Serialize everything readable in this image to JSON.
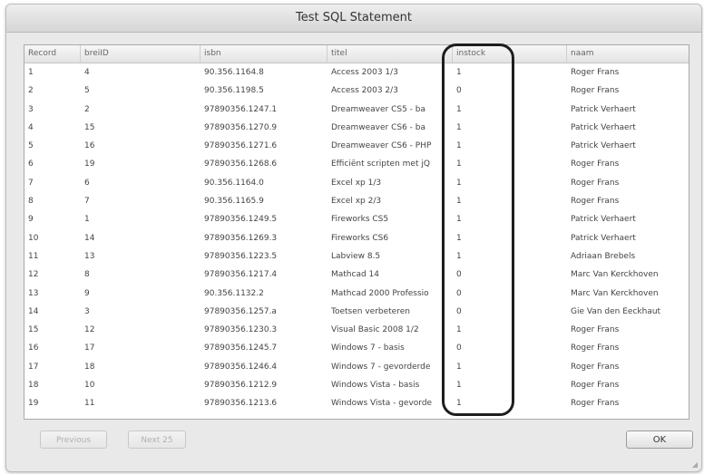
{
  "window": {
    "title": "Test SQL Statement"
  },
  "table": {
    "columns": [
      "Record",
      "breiID",
      "isbn",
      "titel",
      "instock",
      "naam"
    ],
    "rows": [
      [
        "1",
        "4",
        "90.356.1164.8",
        "Access 2003 1/3",
        "1",
        "Roger Frans"
      ],
      [
        "2",
        "5",
        "90.356.1198.5",
        "Access 2003 2/3",
        "0",
        "Roger Frans"
      ],
      [
        "3",
        "2",
        "97890356.1247.1",
        "Dreamweaver CS5 - ba",
        "1",
        "Patrick Verhaert"
      ],
      [
        "4",
        "15",
        "97890356.1270.9",
        "Dreamweaver CS6 - ba",
        "1",
        "Patrick Verhaert"
      ],
      [
        "5",
        "16",
        "97890356.1271.6",
        "Dreamweaver CS6 - PHP",
        "1",
        "Patrick Verhaert"
      ],
      [
        "6",
        "19",
        "97890356.1268.6",
        "Efficiënt scripten met jQ",
        "1",
        "Roger Frans"
      ],
      [
        "7",
        "6",
        "90.356.1164.0",
        "Excel xp 1/3",
        "1",
        "Roger Frans"
      ],
      [
        "8",
        "7",
        "90.356.1165.9",
        "Excel xp 2/3",
        "1",
        "Roger Frans"
      ],
      [
        "9",
        "1",
        "97890356.1249.5",
        "Fireworks CS5",
        "1",
        "Patrick Verhaert"
      ],
      [
        "10",
        "14",
        "97890356.1269.3",
        "Fireworks CS6",
        "1",
        "Patrick Verhaert"
      ],
      [
        "11",
        "13",
        "97890356.1223.5",
        "Labview 8.5",
        "1",
        "Adriaan Brebels"
      ],
      [
        "12",
        "8",
        "97890356.1217.4",
        "Mathcad 14",
        "0",
        "Marc Van Kerckhoven"
      ],
      [
        "13",
        "9",
        "90.356.1132.2",
        "Mathcad 2000 Professio",
        "0",
        "Marc Van Kerckhoven"
      ],
      [
        "14",
        "3",
        "97890356.1257.a",
        "Toetsen verbeteren",
        "0",
        "Gie Van den Eeckhaut"
      ],
      [
        "15",
        "12",
        "97890356.1230.3",
        "Visual Basic 2008 1/2",
        "1",
        "Roger Frans"
      ],
      [
        "16",
        "17",
        "97890356.1245.7",
        "Windows 7 - basis",
        "0",
        "Roger Frans"
      ],
      [
        "17",
        "18",
        "97890356.1246.4",
        "Windows 7 - gevorderde",
        "1",
        "Roger Frans"
      ],
      [
        "18",
        "10",
        "97890356.1212.9",
        "Windows Vista - basis",
        "1",
        "Roger Frans"
      ],
      [
        "19",
        "11",
        "97890356.1213.6",
        "Windows Vista - gevorde",
        "1",
        "Roger Frans"
      ]
    ]
  },
  "buttons": {
    "previous": "Previous",
    "next": "Next 25",
    "ok": "OK"
  }
}
